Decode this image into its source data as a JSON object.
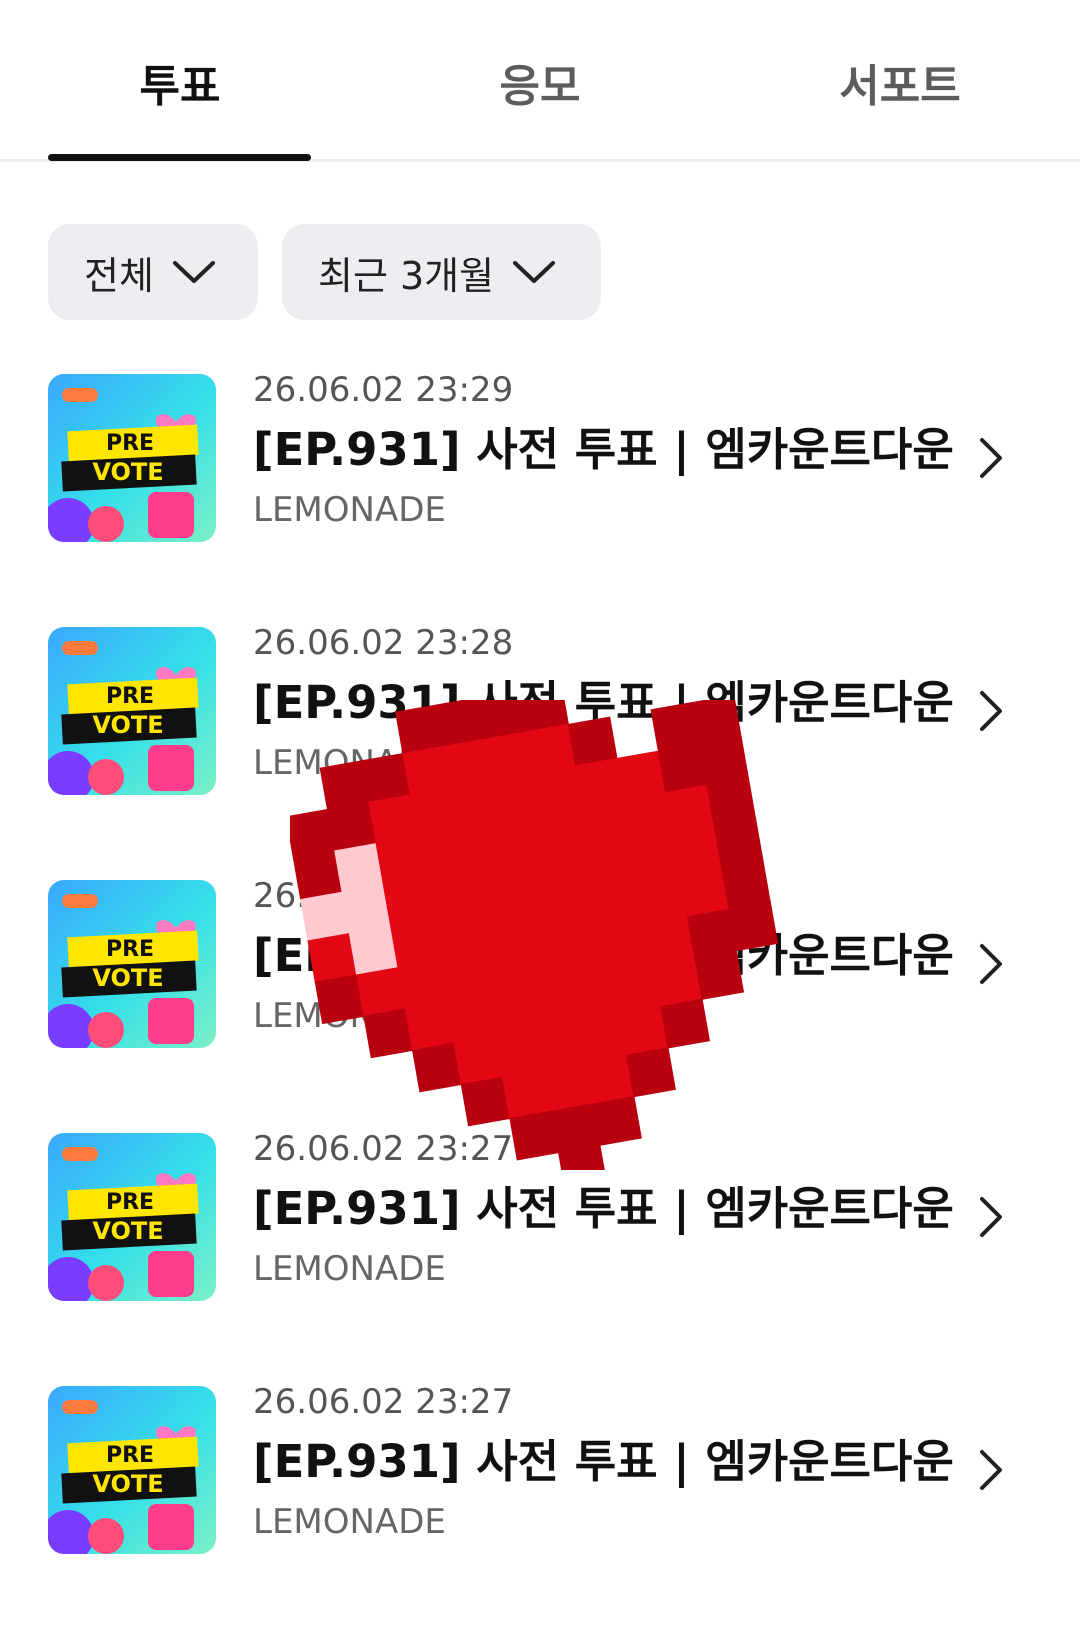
{
  "tabs": [
    {
      "label": "투표",
      "active": true
    },
    {
      "label": "응모",
      "active": false
    },
    {
      "label": "서포트",
      "active": false
    }
  ],
  "filters": [
    {
      "label": "전체"
    },
    {
      "label": "최근 3개월"
    }
  ],
  "items": [
    {
      "date": "26.06.02 23:29",
      "title": "[EP.931] 사전 투표 | 엠카운트다운",
      "source": "LEMONADE",
      "thumb_text": [
        "PRE",
        "VOTE"
      ]
    },
    {
      "date": "26.06.02 23:28",
      "title": "[EP.931] 사전 투표 | 엠카운트다운",
      "source": "LEMONADE",
      "thumb_text": [
        "PRE",
        "VOTE"
      ]
    },
    {
      "date": "26.06.02 23:28",
      "title": "[EP.931] 사전 투표 | 엠카운트다운",
      "source": "LEMONADE",
      "thumb_text": [
        "PRE",
        "VOTE"
      ]
    },
    {
      "date": "26.06.02 23:27",
      "title": "[EP.931] 사전 투표 | 엠카운트다운",
      "source": "LEMONADE",
      "thumb_text": [
        "PRE",
        "VOTE"
      ]
    },
    {
      "date": "26.06.02 23:27",
      "title": "[EP.931] 사전 투표 | 엠카운트다운",
      "source": "LEMONADE",
      "thumb_text": [
        "PRE",
        "VOTE"
      ]
    }
  ],
  "colors": {
    "heart": "#e30613",
    "heart_dark": "#b8000f",
    "heart_highlight": "#ffc9cf",
    "thumb_bg": "#2fd6e8",
    "thumb_banner": "#ffe600"
  },
  "icons": {
    "filter_chevron": "chevron-down-icon",
    "item_chevron": "chevron-right-icon",
    "overlay": "pixel-heart-icon"
  }
}
